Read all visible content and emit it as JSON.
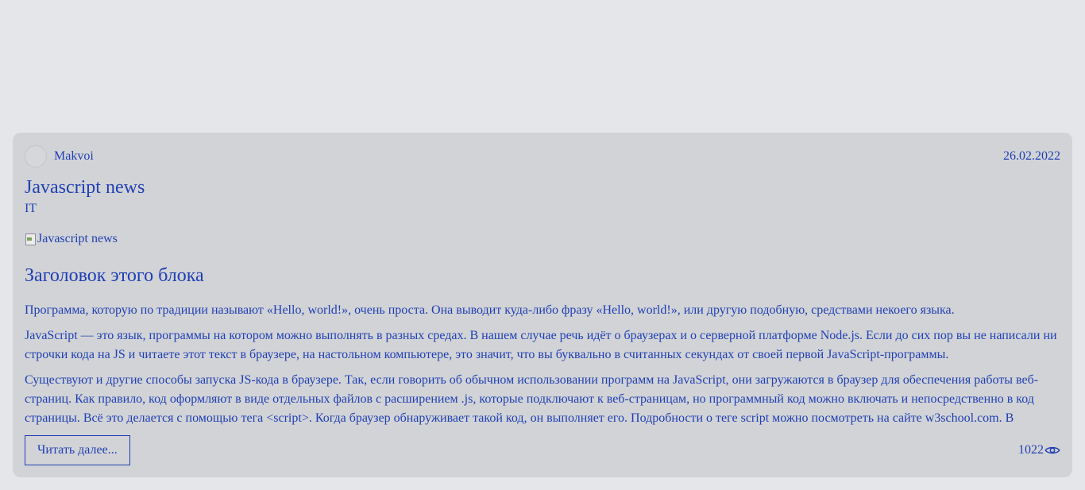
{
  "post": {
    "author": "Makvoi",
    "date": "26.02.2022",
    "title": "Javascript news",
    "category": "IT",
    "image_alt": "Javascript news",
    "block_heading": "Заголовок этого блока",
    "paragraphs": [
      "Программа, которую по традиции называют «Hello, world!», очень проста. Она выводит куда-либо фразу «Hello, world!», или другую подобную, средствами некоего языка.",
      "JavaScript — это язык, программы на котором можно выполнять в разных средах. В нашем случае речь идёт о браузерах и о серверной платформе Node.js. Если до сих пор вы не написали ни строчки кода на JS и читаете этот текст в браузере, на настольном компьютере, это значит, что вы буквально в считанных секундах от своей первой JavaScript-программы.",
      "Существуют и другие способы запуска JS-кода в браузере. Так, если говорить об обычном использовании программ на JavaScript, они загружаются в браузер для обеспечения работы веб-страниц. Как правило, код оформляют в виде отдельных файлов с расширением .js, которые подключают к веб-страницам, но программный код можно включать и непосредственно в код страницы. Всё это делается с помощью тега <script>. Когда браузер обнаруживает такой код, он выполняет его. Подробности о теге script можно посмотреть на сайте w3school.com. В"
    ],
    "read_more_label": "Читать далее...",
    "views": "1022"
  },
  "icons": {
    "views": "eye-icon",
    "image": "broken-image-icon"
  },
  "colors": {
    "text": "#1f3fb4",
    "card_bg": "#d2d3d6",
    "page_bg": "#e5e6e9"
  }
}
